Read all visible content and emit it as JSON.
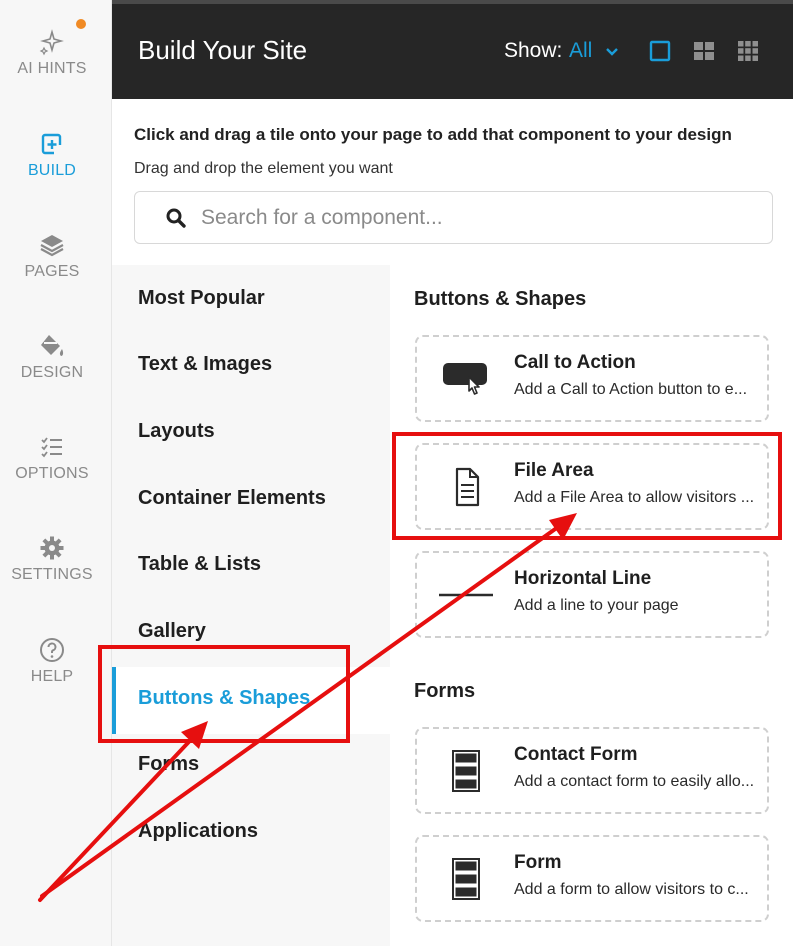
{
  "rail": {
    "items": [
      {
        "label": "AI HINTS",
        "icon": "sparkle-icon"
      },
      {
        "label": "BUILD",
        "icon": "add-box-icon"
      },
      {
        "label": "PAGES",
        "icon": "layers-icon"
      },
      {
        "label": "DESIGN",
        "icon": "paint-bucket-icon"
      },
      {
        "label": "OPTIONS",
        "icon": "checklist-icon"
      },
      {
        "label": "SETTINGS",
        "icon": "gear-icon"
      },
      {
        "label": "HELP",
        "icon": "help-circle-icon"
      }
    ],
    "active": "BUILD"
  },
  "header": {
    "title": "Build Your Site",
    "show_label": "Show:",
    "show_value": "All"
  },
  "intro": {
    "title": "Click and drag a tile onto your page to add that component to your design",
    "subtitle": "Drag and drop the element you want"
  },
  "search": {
    "placeholder": "Search for a component..."
  },
  "categories": [
    "Most Popular",
    "Text & Images",
    "Layouts",
    "Container Elements",
    "Table & Lists",
    "Gallery",
    "Buttons & Shapes",
    "Forms",
    "Applications"
  ],
  "active_category": "Buttons & Shapes",
  "sections": [
    {
      "title": "Buttons & Shapes",
      "cards": [
        {
          "title": "Call to Action",
          "desc": "Add a Call to Action button to e...",
          "icon": "cta-button-icon"
        },
        {
          "title": "File Area",
          "desc": "Add a File Area to allow visitors ...",
          "icon": "document-icon"
        },
        {
          "title": "Horizontal Line",
          "desc": "Add a line to your page",
          "icon": "horizontal-line-icon"
        }
      ]
    },
    {
      "title": "Forms",
      "cards": [
        {
          "title": "Contact Form",
          "desc": "Add a contact form to easily allo...",
          "icon": "form-icon"
        },
        {
          "title": "Form",
          "desc": "Add a form to allow visitors to c...",
          "icon": "form-icon"
        }
      ]
    }
  ],
  "colors": {
    "accent": "#1a9dd9",
    "header_bg": "#262626",
    "annotation": "#e60f0f",
    "notification_dot": "#f08a24"
  }
}
